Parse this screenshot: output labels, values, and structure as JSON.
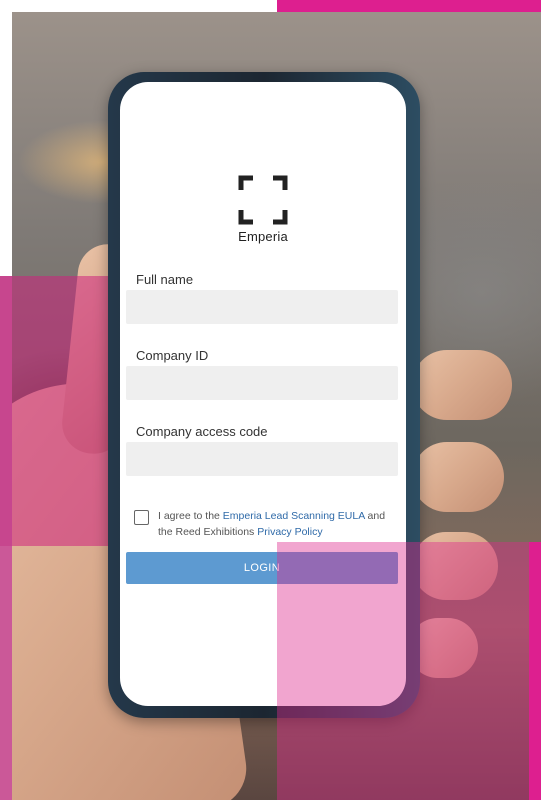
{
  "app": {
    "brand": "Emperia"
  },
  "form": {
    "full_name": {
      "label": "Full name",
      "value": ""
    },
    "company_id": {
      "label": "Company ID",
      "value": ""
    },
    "access_code": {
      "label": "Company access code",
      "value": ""
    }
  },
  "agreement": {
    "text_prefix": "I agree to the ",
    "eula_link": "Emperia Lead Scanning EULA",
    "text_middle": " and the Reed Exhibitions ",
    "privacy_link": "Privacy Policy",
    "checked": false
  },
  "login_label": "LOGIN",
  "colors": {
    "accent_pink": "#dd1f8f",
    "button_blue": "#5d9ad1",
    "link_blue": "#2f6aa8"
  }
}
